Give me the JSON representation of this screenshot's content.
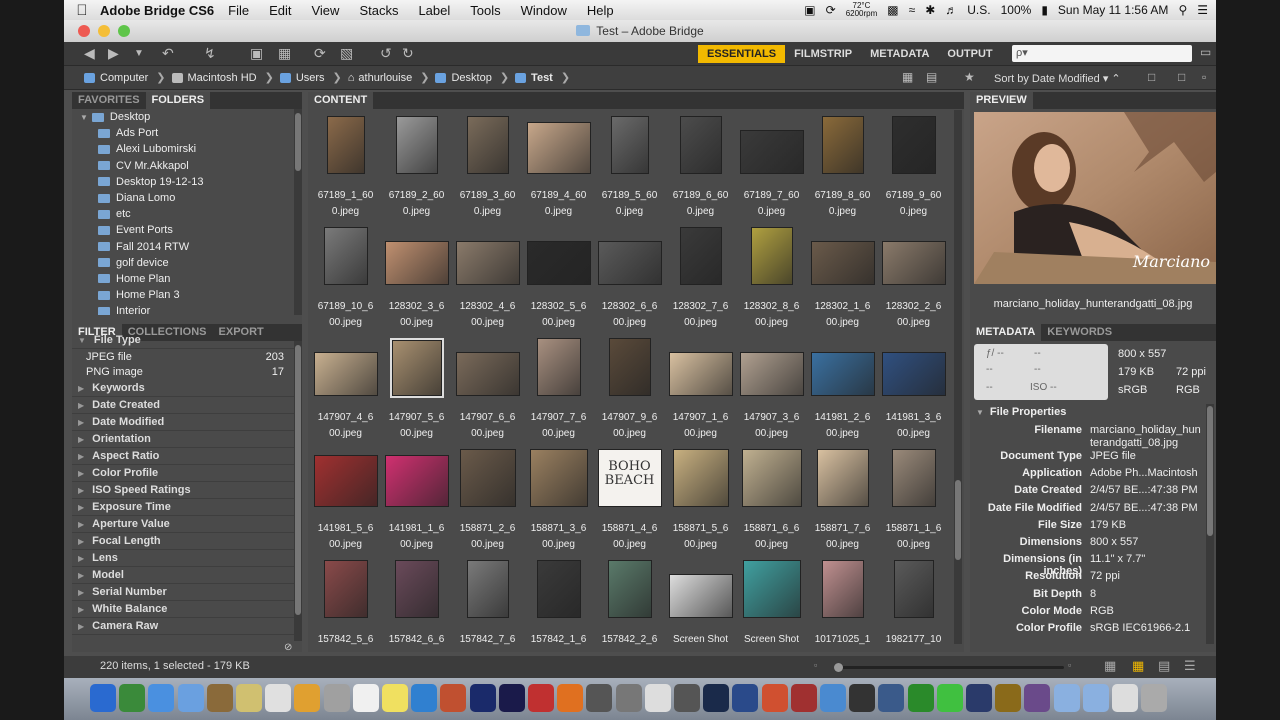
{
  "menubar": {
    "apple": "",
    "app": "Adobe Bridge CS6",
    "items": [
      "File",
      "Edit",
      "View",
      "Stacks",
      "Label",
      "Tools",
      "Window",
      "Help"
    ],
    "temp": "72°C",
    "rpm": "6200rpm",
    "locale": "U.S.",
    "battery": "100%",
    "clock": "Sun May 11  1:56 AM"
  },
  "window": {
    "title": "Test – Adobe Bridge"
  },
  "workspaces": [
    "ESSENTIALS",
    "FILMSTRIP",
    "METADATA",
    "OUTPUT"
  ],
  "search": {
    "placeholder": "ρ▾"
  },
  "path": [
    "Computer",
    "Macintosh HD",
    "Users",
    "athurlouise",
    "Desktop",
    "Test"
  ],
  "sort": {
    "label": "Sort by Date Modified"
  },
  "left": {
    "tabs": [
      "FAVORITES",
      "FOLDERS"
    ],
    "folders": [
      "Desktop",
      "Ads Port",
      "Alexi Lubomirski",
      "CV Mr.Akkapol",
      "Desktop 19-12-13",
      "Diana Lomo",
      "etc",
      "Event Ports",
      "Fall 2014 RTW",
      "golf device",
      "Home Plan",
      "Home Plan 3",
      "Interior"
    ],
    "filter_tabs": [
      "FILTER",
      "COLLECTIONS",
      "EXPORT"
    ],
    "file_type_header": "File Type",
    "file_types": [
      {
        "name": "JPEG file",
        "count": "203"
      },
      {
        "name": "PNG image",
        "count": "17"
      }
    ],
    "criteria": [
      "Keywords",
      "Date Created",
      "Date Modified",
      "Orientation",
      "Aspect Ratio",
      "Color Profile",
      "ISO Speed Ratings",
      "Exposure Time",
      "Aperture Value",
      "Focal Length",
      "Lens",
      "Model",
      "Serial Number",
      "White Balance",
      "Camera Raw"
    ]
  },
  "content": {
    "tab": "CONTENT",
    "items": [
      "67189_1_60\n0.jpeg",
      "67189_2_60\n0.jpeg",
      "67189_3_60\n0.jpeg",
      "67189_4_60\n0.jpeg",
      "67189_5_60\n0.jpeg",
      "67189_6_60\n0.jpeg",
      "67189_7_60\n0.jpeg",
      "67189_8_60\n0.jpeg",
      "67189_9_60\n0.jpeg",
      "67189_10_6\n00.jpeg",
      "128302_3_6\n00.jpeg",
      "128302_4_6\n00.jpeg",
      "128302_5_6\n00.jpeg",
      "128302_6_6\n00.jpeg",
      "128302_7_6\n00.jpeg",
      "128302_8_6\n00.jpeg",
      "128302_1_6\n00.jpeg",
      "128302_2_6\n00.jpeg",
      "147907_4_6\n00.jpeg",
      "147907_5_6\n00.jpeg",
      "147907_6_6\n00.jpeg",
      "147907_7_6\n00.jpeg",
      "147907_9_6\n00.jpeg",
      "147907_1_6\n00.jpeg",
      "147907_3_6\n00.jpeg",
      "141981_2_6\n00.jpeg",
      "141981_3_6\n00.jpeg",
      "141981_5_6\n00.jpeg",
      "141981_1_6\n00.jpeg",
      "158871_2_6\n00.jpeg",
      "158871_3_6\n00.jpeg",
      "158871_4_6\n00.jpeg",
      "158871_5_6\n00.jpeg",
      "158871_6_6\n00.jpeg",
      "158871_7_6\n00.jpeg",
      "158871_1_6\n00.jpeg",
      "157842_5_6",
      "157842_6_6",
      "157842_7_6",
      "157842_1_6",
      "157842_2_6",
      "Screen Shot",
      "Screen Shot",
      "10171025_1",
      "1982177_10"
    ],
    "thumb_colors": [
      "#8b6a4a",
      "#9a9a9a",
      "#7a6b5a",
      "#c7a78a",
      "#6a6a6a",
      "#4c4c4c",
      "#3a3a3a",
      "#8a6a3a",
      "#2e2e2e",
      "#7a7a7a",
      "#c09070",
      "#8a7a6a",
      "#2a2a2a",
      "#5a5a5a",
      "#3a3a3a",
      "#b0a040",
      "#6a5a4a",
      "#8a7a6a",
      "#c8b090",
      "#a89070",
      "#7a6a5a",
      "#a89080",
      "#5a4a3a",
      "#d8c0a0",
      "#b0a090",
      "#3a70a0",
      "#305080",
      "#a03030",
      "#d03070",
      "#6a5a4a",
      "#9a8060",
      "#f2f2f2",
      "#c8b080",
      "#c0b090",
      "#d8c0a0",
      "#9a8a7a",
      "#8a4a4a",
      "#6a4a5a",
      "#7a7a7a",
      "#3a3a3a",
      "#5a7a6a",
      "#ddd",
      "#40a0a0",
      "#c09090",
      "#5a5a5a"
    ],
    "brand_text": "BOHO BEACH"
  },
  "preview": {
    "tab": "PREVIEW",
    "caption": "marciano_holiday_hunterandgatti_08.jpg",
    "watermark": "Marciano"
  },
  "metadata": {
    "tabs": [
      "METADATA",
      "KEYWORDS"
    ],
    "box": {
      "dims": "800 x 557",
      "size": "179 KB",
      "ppi": "72 ppi",
      "space": "sRGB",
      "mode": "RGB",
      "f": "ƒ/ --",
      "iso": "ISO --"
    },
    "section": "File Properties",
    "rows": [
      {
        "k": "Filename",
        "v": "marciano_holiday_hunterandgatti_08.jpg"
      },
      {
        "k": "Document Type",
        "v": "JPEG file"
      },
      {
        "k": "Application",
        "v": "Adobe Ph...Macintosh"
      },
      {
        "k": "Date Created",
        "v": "2/4/57 BE...:47:38 PM"
      },
      {
        "k": "Date File Modified",
        "v": "2/4/57 BE...:47:38 PM"
      },
      {
        "k": "File Size",
        "v": "179 KB"
      },
      {
        "k": "Dimensions",
        "v": "800 x 557"
      },
      {
        "k": "Dimensions (in inches)",
        "v": "11.1\" x 7.7\""
      },
      {
        "k": "Resolution",
        "v": "72 ppi"
      },
      {
        "k": "Bit Depth",
        "v": "8"
      },
      {
        "k": "Color Mode",
        "v": "RGB"
      },
      {
        "k": "Color Profile",
        "v": "sRGB IEC61966-2.1"
      }
    ]
  },
  "status": {
    "text": "220 items, 1 selected - 179 KB"
  },
  "colors": {
    "accent": "#f2b900",
    "panel": "#4a4a4a",
    "folder": "#7aa6d4"
  },
  "dock": [
    "#2a6ad0",
    "#3a8a3a",
    "#4a90e0",
    "#6aa0e0",
    "#8a6a3a",
    "#d0c070",
    "#e0e0e0",
    "#e0a030",
    "#a0a0a0",
    "#f0f0f0",
    "#f0e060",
    "#3080d0",
    "#c05030",
    "#1a2a6a",
    "#1a1a4a",
    "#c03030",
    "#e07020",
    "#555",
    "#777",
    "#ddd",
    "#555",
    "#1a2a4a",
    "#2a4a8a",
    "#d05030",
    "#a03030",
    "#4a8ad0",
    "#333",
    "#3a5a8a",
    "#2a8a2a",
    "#40c040",
    "#2a3a6a",
    "#8a6a1a",
    "#6a4a8a",
    "#8ab0e0",
    "#8ab0e0",
    "#ddd",
    "#aaa"
  ]
}
